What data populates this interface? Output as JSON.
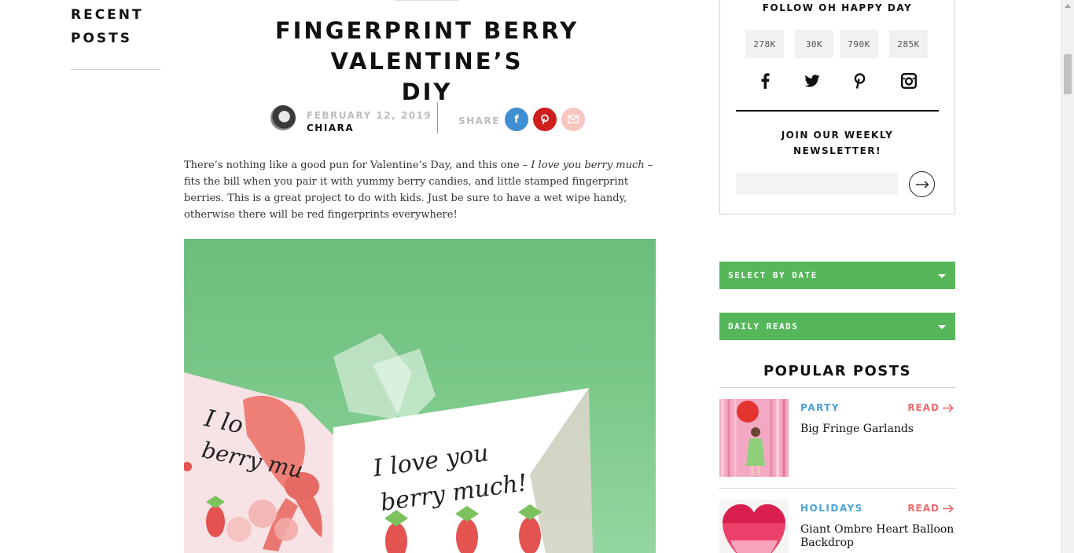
{
  "recent_posts": {
    "title_line1": "RECENT",
    "title_line2": "POSTS"
  },
  "post": {
    "title_line1": "FINGERPRINT BERRY VALENTINE’S",
    "title_line2": "DIY",
    "date": "FEBRUARY 12, 2019",
    "author": "CHIARA",
    "share_label": "SHARE",
    "intro_before": "There’s nothing like a good pun for Valentine’s Day, and this one – ",
    "intro_emphasis": "I love you berry much",
    "intro_after": " – fits the bill when you pair it with yummy berry candies, and little stamped fingerprint berries. This is a great project to do with kids. Just be sure to have a wet wipe handy, otherwise there will be red fingerprints everywhere!",
    "hero_card_text_line1": "I love you",
    "hero_card_text_line2": "berry much!",
    "hero_back_card_line1": "I lo",
    "hero_back_card_line2": "berry mu"
  },
  "share_icons": {
    "facebook": "facebook-icon",
    "pinterest": "pinterest-icon",
    "email": "email-icon"
  },
  "follow": {
    "title": "FOLLOW OH HAPPY DAY",
    "counts": [
      {
        "network": "facebook",
        "value": "278K",
        "icon": "facebook-icon"
      },
      {
        "network": "twitter",
        "value": "30K",
        "icon": "twitter-icon"
      },
      {
        "network": "pinterest",
        "value": "790K",
        "icon": "pinterest-icon"
      },
      {
        "network": "instagram",
        "value": "285K",
        "icon": "instagram-icon"
      }
    ]
  },
  "newsletter": {
    "title_line1": "JOIN OUR WEEKLY",
    "title_line2": "NEWSLETTER!",
    "placeholder": "",
    "submit_icon": "arrow-right-icon"
  },
  "dropdowns": {
    "by_date": "SELECT BY DATE",
    "daily_reads": "DAILY READS"
  },
  "popular": {
    "title": "POPULAR POSTS",
    "items": [
      {
        "category": "PARTY",
        "read": "READ",
        "name": "Big Fringe Garlands"
      },
      {
        "category": "HOLIDAYS",
        "read": "READ",
        "name": "Giant Ombre Heart Balloon Backdrop"
      }
    ]
  },
  "colors": {
    "green": "#56b75a",
    "link_blue": "#4aa3d9",
    "read_red": "#f16a6a",
    "pinterest_red": "#cf1e1e",
    "facebook_blue": "#3f8fd0"
  }
}
